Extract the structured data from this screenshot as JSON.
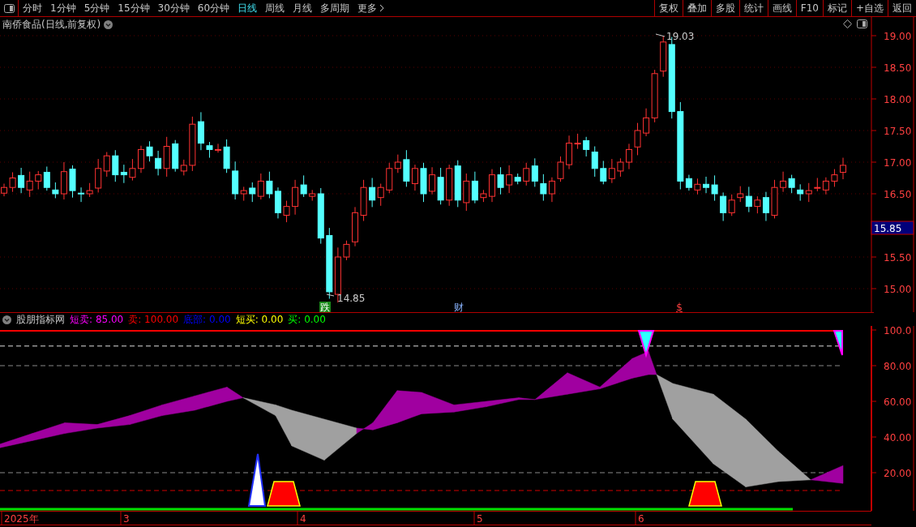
{
  "toolbar": {
    "periods": [
      {
        "label": "分时",
        "selected": false
      },
      {
        "label": "1分钟",
        "selected": false
      },
      {
        "label": "5分钟",
        "selected": false
      },
      {
        "label": "15分钟",
        "selected": false
      },
      {
        "label": "30分钟",
        "selected": false
      },
      {
        "label": "60分钟",
        "selected": false
      },
      {
        "label": "日线",
        "selected": true
      },
      {
        "label": "周线",
        "selected": false
      },
      {
        "label": "月线",
        "selected": false
      },
      {
        "label": "多周期",
        "selected": false
      }
    ],
    "more": "更多",
    "actions": [
      "复权",
      "叠加",
      "多股",
      "统计",
      "画线",
      "F10",
      "标记",
      "+自选",
      "返回"
    ]
  },
  "price_chart": {
    "title": "南侨食品(日线,前复权)",
    "axis_labels": [
      "19.00",
      "18.50",
      "18.00",
      "17.50",
      "17.00",
      "16.50",
      "15.50",
      "15.00"
    ],
    "current_price": "15.85",
    "high_label": "19.03",
    "low_label": "14.85",
    "event_marks": [
      {
        "text": "跌",
        "kind": "boxed"
      },
      {
        "text": "财",
        "kind": "plain"
      },
      {
        "text": "$",
        "kind": "underlined"
      }
    ]
  },
  "indicator": {
    "name": "股朋指标网",
    "readings": [
      {
        "label": "短卖:",
        "value": "85.00",
        "color": "#ff00ff"
      },
      {
        "label": "卖:",
        "value": "100.00",
        "color": "#ff0000"
      },
      {
        "label": "底部:",
        "value": "0.00",
        "color": "#0000ff"
      },
      {
        "label": "短买:",
        "value": "0.00",
        "color": "#ffff00"
      },
      {
        "label": "买:",
        "value": "0.00",
        "color": "#00ff00"
      }
    ],
    "axis_labels": [
      "100.0",
      "80.00",
      "60.00",
      "40.00",
      "20.00"
    ]
  },
  "date_axis": {
    "labels": [
      "2025年",
      "3",
      "4",
      "5",
      "6"
    ]
  }
}
